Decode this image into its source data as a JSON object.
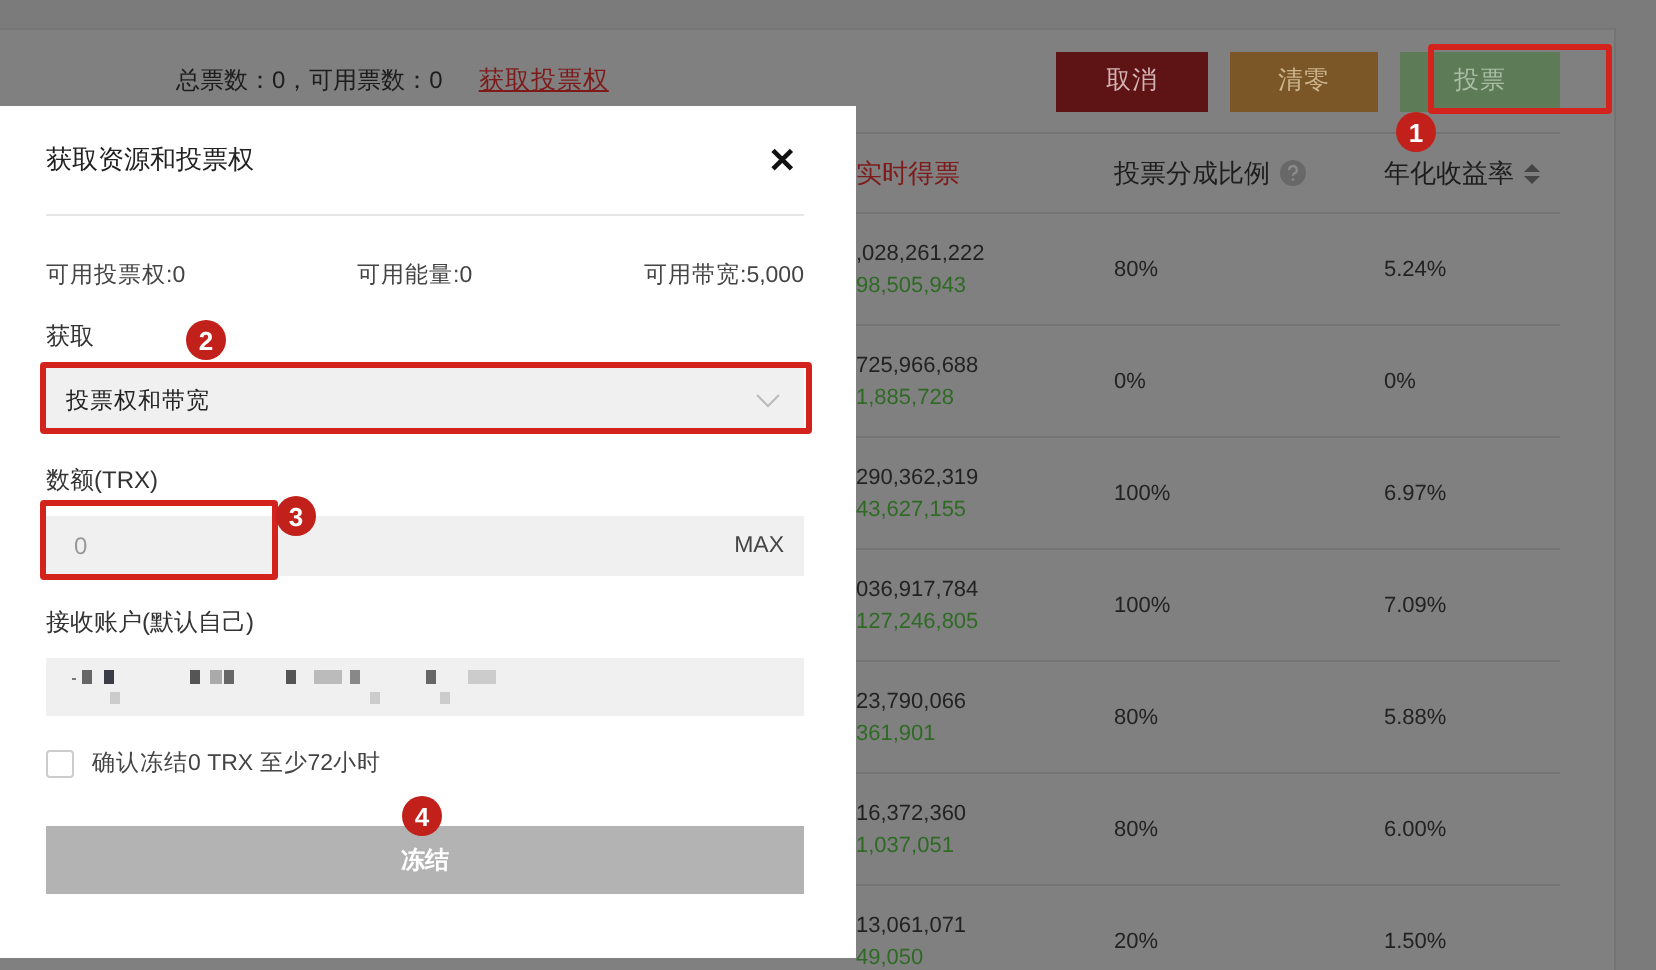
{
  "header": {
    "vote_summary": "总票数：0，可用票数：0",
    "get_votes_link": "获取投票权",
    "buttons": [
      {
        "label": "取消",
        "kind": "cancel"
      },
      {
        "label": "清零",
        "kind": "reset"
      },
      {
        "label": "投票",
        "kind": "vote"
      }
    ]
  },
  "table": {
    "columns": [
      {
        "label": "实时得票",
        "kind": "highlight"
      },
      {
        "label": "投票分成比例",
        "kind": "help"
      },
      {
        "label": "年化收益率",
        "kind": "sortable"
      }
    ],
    "rows": [
      {
        "votes": ",028,261,222",
        "change": "98,505,943",
        "share": "80%",
        "annual_yield": "5.24%"
      },
      {
        "votes": "725,966,688",
        "change": "1,885,728",
        "share": "0%",
        "annual_yield": "0%"
      },
      {
        "votes": "290,362,319",
        "change": "43,627,155",
        "share": "100%",
        "annual_yield": "6.97%"
      },
      {
        "votes": "036,917,784",
        "change": "127,246,805",
        "share": "100%",
        "annual_yield": "7.09%"
      },
      {
        "votes": "23,790,066",
        "change": "361,901",
        "share": "80%",
        "annual_yield": "5.88%"
      },
      {
        "votes": "16,372,360",
        "change": "1,037,051",
        "share": "80%",
        "annual_yield": "6.00%"
      },
      {
        "votes": "13,061,071",
        "change": "49,050",
        "share": "20%",
        "annual_yield": "1.50%"
      }
    ]
  },
  "dialog": {
    "title": "获取资源和投票权",
    "close": "✕",
    "stats": [
      "可用投票权:0",
      "可用能量:0",
      "可用带宽:5,000"
    ],
    "obtain_label": "获取",
    "obtain_select": {
      "value": "投票权和带宽"
    },
    "amount_label": "数额(TRX)",
    "amount_input": {
      "placeholder": "0"
    },
    "max_button": "MAX",
    "receiver_label": "接收账户(默认自己)",
    "confirm": {
      "label": "确认冻结0 TRX 至少72小时",
      "checked": false
    },
    "submit": {
      "label": "冻结",
      "disabled": true
    }
  },
  "annotations": [
    {
      "label": "1",
      "framed": true
    },
    {
      "label": "2",
      "framed": true
    },
    {
      "label": "3",
      "framed": true
    },
    {
      "label": "4",
      "framed": false
    }
  ]
}
